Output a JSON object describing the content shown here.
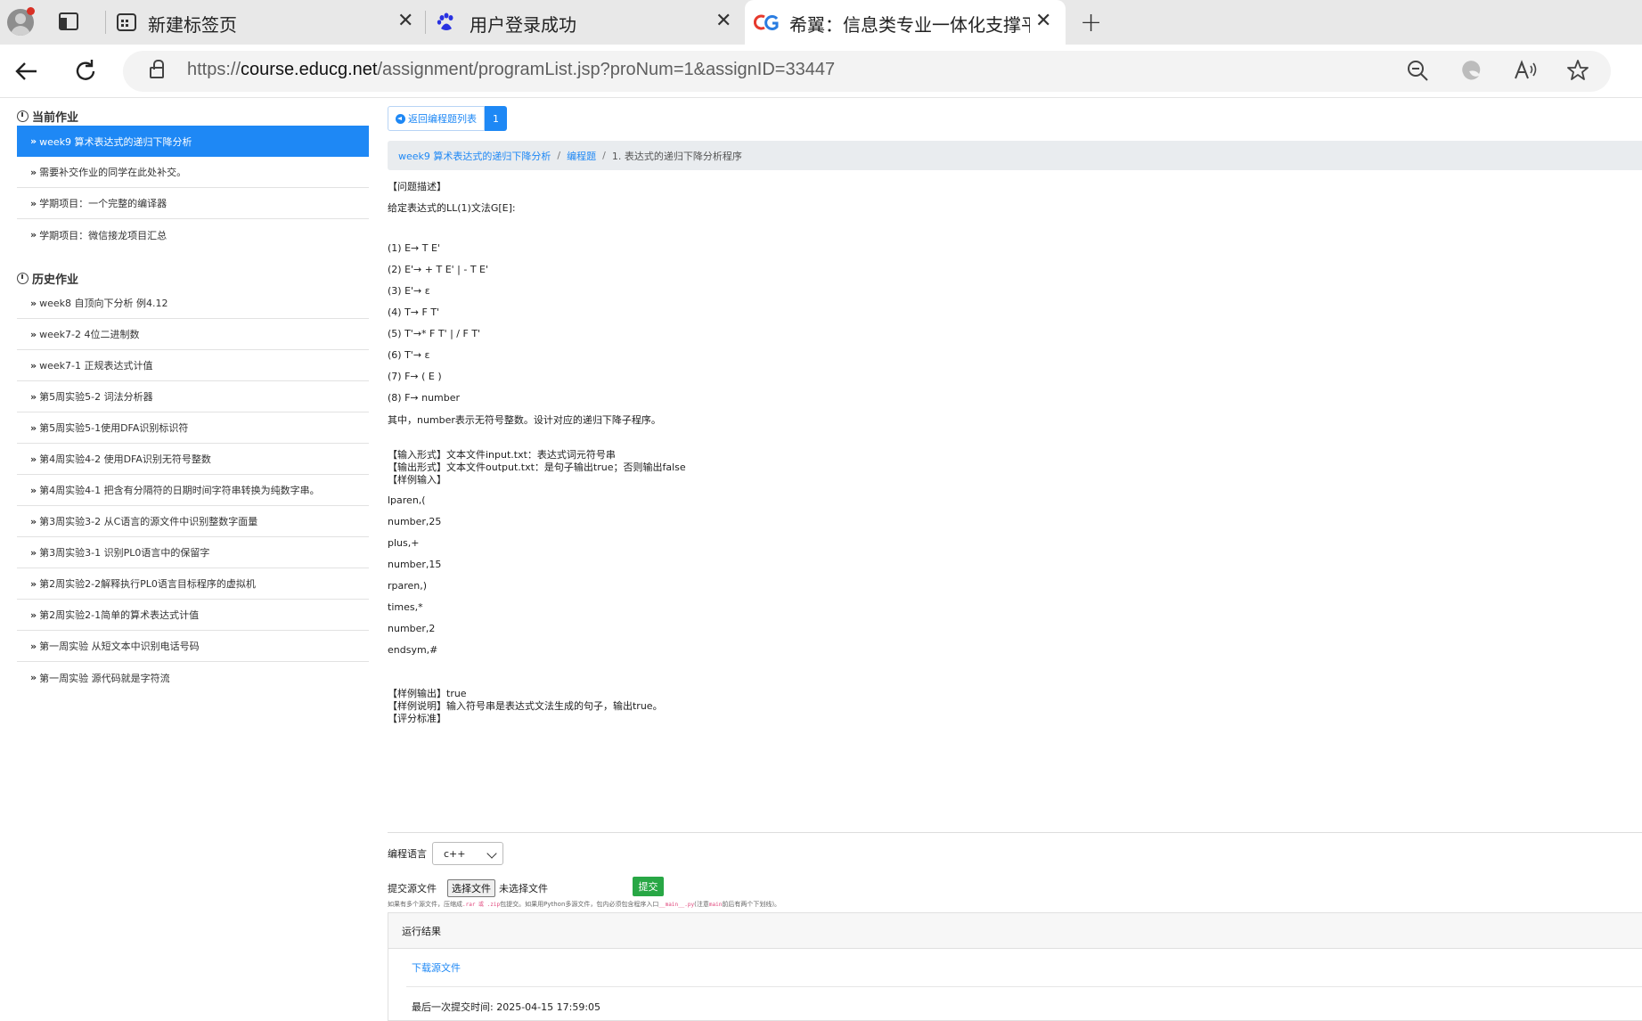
{
  "browser": {
    "tabs": [
      {
        "label": "新建标签页",
        "close": "✕"
      },
      {
        "label": "用户登录成功",
        "close": "✕"
      },
      {
        "label": "希翼：信息类专业一体化支撑平台",
        "close": "✕"
      }
    ],
    "new_tab": "+",
    "url_scheme": "https://",
    "url_domain": "course.educg.net",
    "url_path": "/assignment/programList.jsp?proNum=1&assignID=33447"
  },
  "sidebar": {
    "current_title": "当前作业",
    "current_items": [
      "week9 算术表达式的递归下降分析",
      "需要补交作业的同学在此处补交。",
      "学期项目：一个完整的编译器",
      "学期项目：微信接龙项目汇总"
    ],
    "history_title": "历史作业",
    "history_items": [
      "week8 自顶向下分析 例4.12",
      "week7-2 4位二进制数",
      "week7-1 正规表达式计值",
      "第5周实验5-2 词法分析器",
      "第5周实验5-1使用DFA识别标识符",
      "第4周实验4-2 使用DFA识别无符号整数",
      "第4周实验4-1 把含有分隔符的日期时间字符串转换为纯数字串。",
      "第3周实验3-2 从C语言的源文件中识别整数字面量",
      "第3周实验3-1 识别PL0语言中的保留字",
      "第2周实验2-2解释执行PL0语言目标程序的虚拟机",
      "第2周实验2-1简单的算术表达式计值",
      "第一周实验 从短文本中识别电话号码",
      "第一周实验 源代码就是字符流"
    ]
  },
  "main": {
    "back_label": "返回编程题列表",
    "page_number": "1",
    "breadcrumb": {
      "c1": "week9 算术表达式的递归下降分析",
      "c2": "编程题",
      "c3": "1. 表达式的递归下降分析程序",
      "sep": "/"
    },
    "desc_lines": [
      "【问题描述】",
      "给定表达式的LL(1)文法G[E]:",
      "(1) E→ T E'",
      "(2) E'→ + T E' | - T E'",
      "(3) E'→ ε",
      "(4) T→ F T'",
      "(5) T'→* F T' | / F T'",
      "(6) T'→ ε",
      "(7) F→ ( E )",
      "(8) F→ number",
      "其中，number表示无符号整数。设计对应的递归下降子程序。",
      "【输入形式】文本文件input.txt：表达式词元符号串",
      "【输出形式】文本文件output.txt：是句子输出true；否则输出false",
      "【样例输入】",
      "lparen,(",
      "number,25",
      "plus,+",
      "number,15",
      "rparen,)",
      "times,*",
      "number,2",
      "endsym,#",
      "【样例输出】true",
      "【样例说明】输入符号串是表达式文法生成的句子，输出true。",
      "【评分标准】"
    ],
    "lang_label": "编程语言",
    "lang_value": "c++",
    "file_label": "提交源文件",
    "file_button": "选择文件",
    "file_none": "未选择文件",
    "submit": "提交",
    "hint_a": "如果有多个源文件，压缩成",
    "hint_code1": ".rar 或 .zip",
    "hint_b": "包提交。如果用Python多源文件，包内必须包含程序入口",
    "hint_code2": "__main__.py",
    "hint_c": "(注意",
    "hint_code3": "main",
    "hint_d": "前后有两个下划线)。",
    "result_title": "运行结果",
    "download_link": "下载源文件",
    "last_submit": "最后一次提交时间: 2025-04-15 17:59:05"
  }
}
